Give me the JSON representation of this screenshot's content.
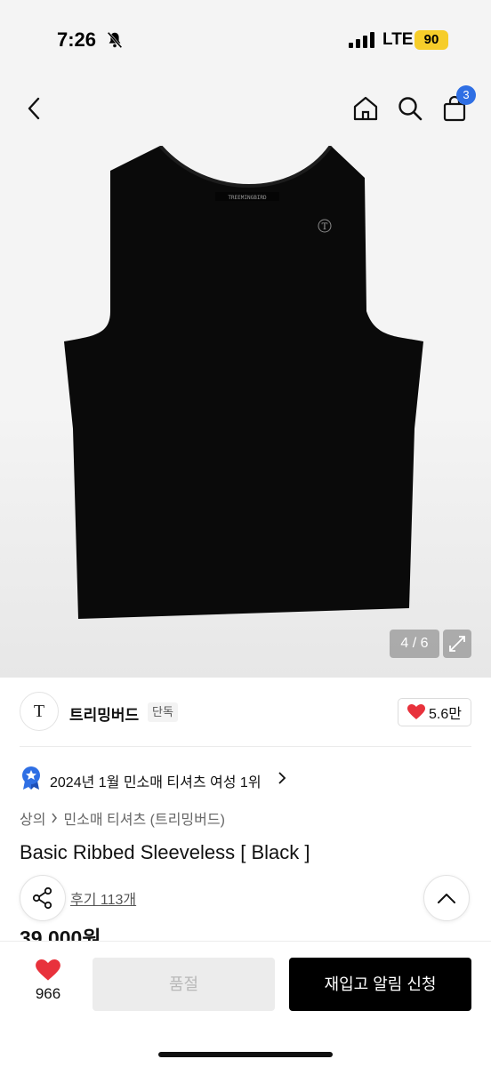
{
  "status_bar": {
    "time": "7:26",
    "network": "LTE",
    "battery": "90"
  },
  "header": {
    "cart_count": "3"
  },
  "gallery": {
    "counter": "4 / 6",
    "garment_label": "TREEMINGBIRD",
    "garment_logo": "T"
  },
  "brand": {
    "logo_letter": "T",
    "name": "트리밍버드",
    "tag": "단독",
    "likes": "5.6만"
  },
  "ranking": {
    "text": "2024년 1월 민소매 티셔츠 여성 1위"
  },
  "breadcrumb": {
    "items": [
      "상의",
      "민소매 티셔츠 (트리밍버드)"
    ]
  },
  "product": {
    "title": "Basic Ribbed Sleeveless [ Black ]",
    "reviews": "후기 113개",
    "price": "39,000원"
  },
  "bottom_bar": {
    "wish_count": "966",
    "soldout_label": "품절",
    "restock_label": "재입고 알림 신청"
  },
  "colors": {
    "accent_blue": "#2f6fe4",
    "heart_red": "#e8323c",
    "battery_yellow": "#f6cd2a",
    "primary_button": "#000000"
  },
  "icons": [
    "back-icon",
    "home-icon",
    "search-icon",
    "cart-icon",
    "expand-icon",
    "heart-icon",
    "ranking-medal-icon",
    "chevron-right-icon",
    "share-icon",
    "chevron-up-icon",
    "bell-slash-icon",
    "signal-icon"
  ]
}
